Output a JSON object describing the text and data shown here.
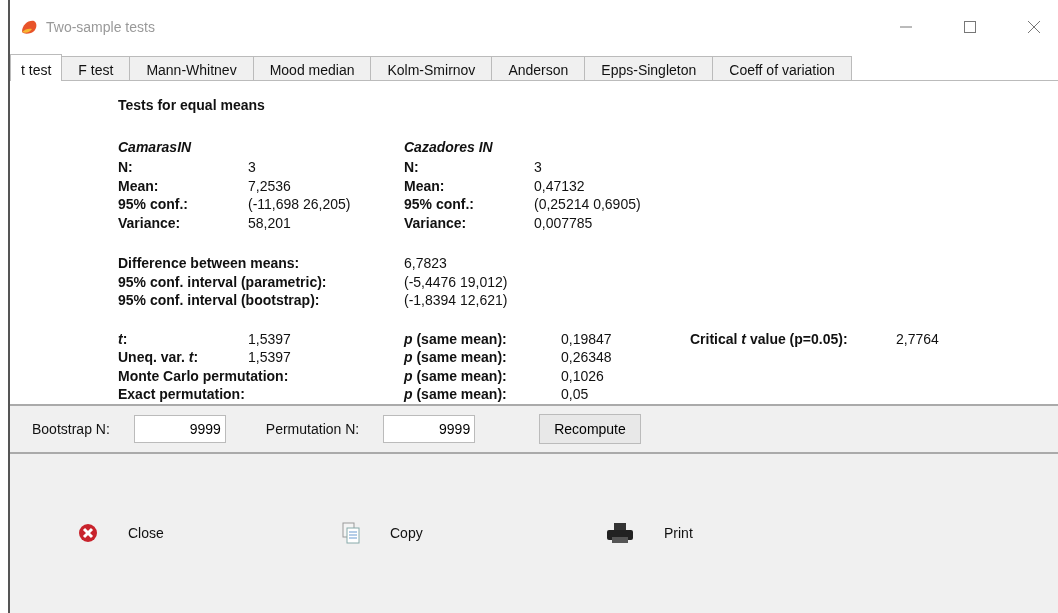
{
  "window": {
    "title": "Two-sample tests"
  },
  "tabs": [
    {
      "label": "t test",
      "selected": true
    },
    {
      "label": "F test",
      "selected": false
    },
    {
      "label": "Mann-Whitnev",
      "selected": false
    },
    {
      "label": "Mood median",
      "selected": false
    },
    {
      "label": "Kolm-Smirnov",
      "selected": false
    },
    {
      "label": "Anderson",
      "selected": false
    },
    {
      "label": "Epps-Singleton",
      "selected": false
    },
    {
      "label": "Coeff of variation",
      "selected": false
    }
  ],
  "heading": "Tests for equal means",
  "samples": [
    {
      "name": "CamarasIN",
      "rows": [
        {
          "label": "N:",
          "value": "3"
        },
        {
          "label": "Mean:",
          "value": "7,2536"
        },
        {
          "label": "95% conf.:",
          "value": "(-11,698 26,205)"
        },
        {
          "label": "Variance:",
          "value": "58,201"
        }
      ]
    },
    {
      "name": "Cazadores IN",
      "rows": [
        {
          "label": "N:",
          "value": "3"
        },
        {
          "label": "Mean:",
          "value": "0,47132"
        },
        {
          "label": "95% conf.:",
          "value": "(0,25214 0,6905)"
        },
        {
          "label": "Variance:",
          "value": "0,007785"
        }
      ]
    }
  ],
  "difference": [
    {
      "label": "Difference between means:",
      "value": "6,7823"
    },
    {
      "label": "95% conf. interval (parametric):",
      "value": "(-5,4476 19,012)"
    },
    {
      "label": "95% conf. interval (bootstrap):",
      "value": "(-1,8394 12,621)"
    }
  ],
  "tests": [
    {
      "label": "*t*:",
      "value": "1,5397",
      "p_label": "*p* (same mean):",
      "p_value": "0,19847"
    },
    {
      "label": "Uneq. var. *t*:",
      "value": "1,5397",
      "p_label": "*p* (same mean):",
      "p_value": "0,26348"
    },
    {
      "label": "Monte Carlo permutation:",
      "p_label": "*p* (same mean):",
      "p_value": "0,1026"
    },
    {
      "label": "Exact permutation:",
      "p_label": "*p* (same mean):",
      "p_value": "0,05"
    }
  ],
  "critical": {
    "label": "Critical *t* value (p=0.05):",
    "value": "2,7764"
  },
  "fields": [
    {
      "label": "Bootstrap N:",
      "value": "9999"
    },
    {
      "label": "Permutation N:",
      "value": "9999"
    }
  ],
  "recompute": "Recompute",
  "toolbar": [
    {
      "kind": "close",
      "label": "Close"
    },
    {
      "kind": "copy",
      "label": "Copy"
    },
    {
      "kind": "print",
      "label": "Print"
    }
  ]
}
